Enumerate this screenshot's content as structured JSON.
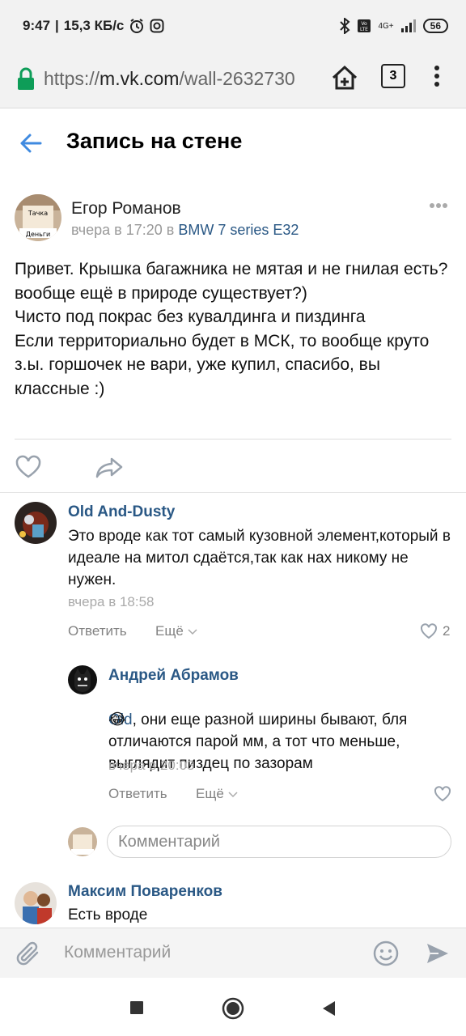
{
  "status": {
    "time": "9:47",
    "speed": "15,3 КБ/с",
    "net": "4G+",
    "battery": "56"
  },
  "browser": {
    "url_scheme": "https://",
    "url_host": "m.vk.com",
    "url_path": "/wall-2632730",
    "tab_count": "3"
  },
  "header": {
    "title": "Запись на стене"
  },
  "post": {
    "author": "Егор Романов",
    "time": "вчера в 17:20 в ",
    "group": "BMW 7 series E32",
    "avatar_labels": [
      "Тачка",
      "Деньги"
    ],
    "text": "Привет. Крышка багажника не мятая и не гнилая есть?\nвообще ещё в природе существует?)\nЧисто под покрас без кувалдинга и пиздинга\nЕсли территориально будет в МСК, то вообще круто\nз.ы. горшочек не вари, уже купил, спасибо, вы классные :)"
  },
  "comments": [
    {
      "name": "Old And-Dusty",
      "text": "Это вроде как тот самый кузовной элемент,который в идеале на митол сдаётся,так как нах никому не нужен.",
      "time": "вчера в 18:58",
      "reply": "Ответить",
      "more": "Ещё",
      "likes": "2"
    },
    {
      "name": "Андрей Абрамов",
      "mention": "Old",
      "text": ", они еще разной ширины бывают, бля\n отличаются парой мм, а тот что меньше, выглядит пиздец по зазорам",
      "emoji": "😂",
      "time": "вчера в 20:03",
      "reply": "Ответить",
      "more": "Ещё"
    },
    {
      "name": "Максим Поваренков",
      "text": "Есть вроде"
    }
  ],
  "reply_input": {
    "placeholder": "Комментарий"
  },
  "bottom_input": {
    "placeholder": "Комментарий"
  },
  "colors": {
    "link": "#2a5885",
    "accent": "#3f8ae0"
  }
}
